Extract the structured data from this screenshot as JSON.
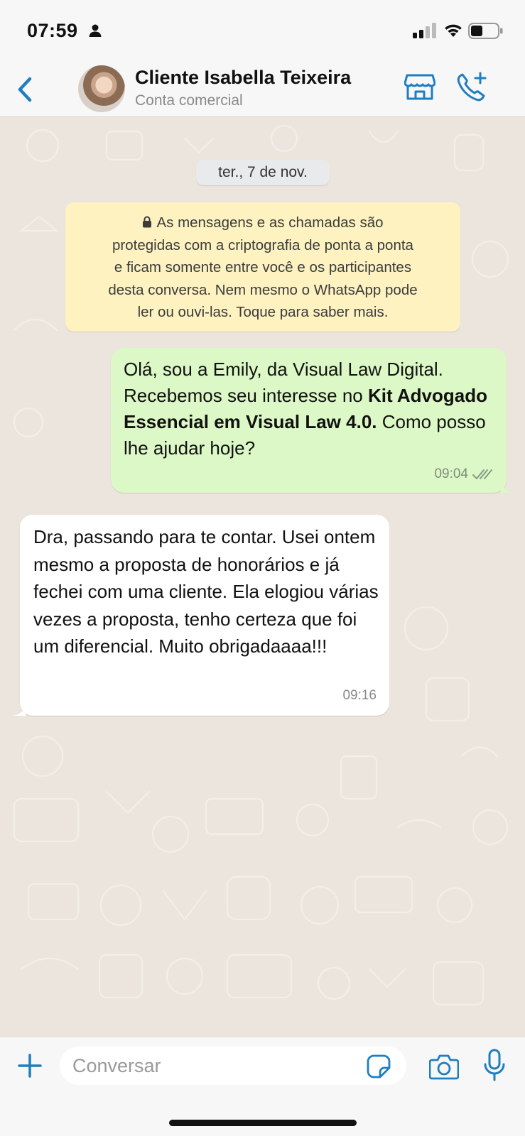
{
  "status_bar": {
    "time": "07:59"
  },
  "header": {
    "back_icon": "chevron-left-icon",
    "contact_name": "Cliente Isabella Teixeira",
    "contact_subtitle": "Conta comercial",
    "store_icon": "storefront-icon",
    "call_icon": "add-call-icon",
    "accent_color": "#1f7ec0"
  },
  "chat": {
    "date_chip": "ter., 7 de nov.",
    "encryption_notice": {
      "line1": "As mensagens e as chamadas são",
      "line2": "protegidas com a criptografia de ponta a ponta",
      "line3": "e ficam somente entre você e os participantes",
      "line4": "desta conversa. Nem mesmo o WhatsApp pode",
      "line5": "ler ou ouvi-las. Toque para saber mais."
    },
    "messages": [
      {
        "direction": "outgoing",
        "text_part1": "Olá, sou a Emily, da Visual Law Digital. Recebemos seu interesse no ",
        "text_bold": "Kit Advogado Essencial em Visual Law 4.0.",
        "text_part2": " Como posso lhe ajudar hoje?",
        "time": "09:04",
        "status": "delivered",
        "bubble_color": "#dcf8c6"
      },
      {
        "direction": "incoming",
        "text": "Dra, passando para te contar. Usei ontem mesmo a proposta de honorários e já fechei com uma cliente. Ela elogiou várias vezes a proposta, tenho certeza que foi um diferencial. Muito obrigadaaaa!!!",
        "time": "09:16",
        "bubble_color": "#ffffff"
      }
    ]
  },
  "input_bar": {
    "placeholder": "Conversar",
    "plus_icon": "plus-icon",
    "sticker_icon": "sticker-icon",
    "camera_icon": "camera-icon",
    "mic_icon": "microphone-icon"
  }
}
